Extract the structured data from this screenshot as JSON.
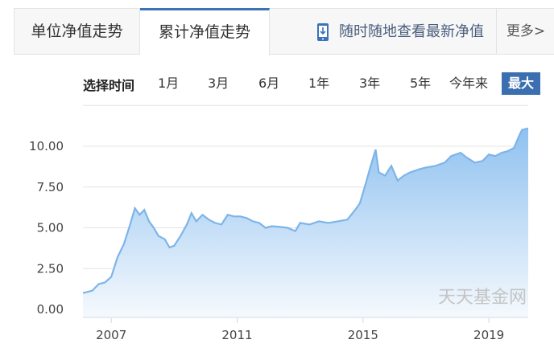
{
  "tabs": {
    "unit_nav": "单位净值走势",
    "cumulative_nav": "累计净值走势",
    "mobile_text": "随时随地查看最新净值",
    "more": "更多>"
  },
  "range": {
    "title": "选择时间",
    "options": [
      "1月",
      "3月",
      "6月",
      "1年",
      "3年",
      "5年",
      "今年来",
      "最大"
    ],
    "selected": "最大"
  },
  "colors": {
    "accent": "#3b6fb0",
    "line": "#7db4ea",
    "fill_top": "#8fc1f0",
    "fill_bottom": "#f5f9fd"
  },
  "watermark": "天天基金网",
  "chart_data": {
    "type": "area",
    "y_ticks": [
      "0.00",
      "2.50",
      "5.00",
      "7.50",
      "10.00"
    ],
    "x_ticks": [
      {
        "year": 2007,
        "label": "2007"
      },
      {
        "year": 2011,
        "label": "2011"
      },
      {
        "year": 2015,
        "label": "2015"
      },
      {
        "year": 2019,
        "label": "2019"
      }
    ],
    "xlim": [
      2006.1,
      2020.25
    ],
    "ylim": [
      0,
      10.2
    ],
    "grid": true,
    "points": [
      [
        2006.1,
        1.0
      ],
      [
        2006.4,
        1.15
      ],
      [
        2006.6,
        1.55
      ],
      [
        2006.8,
        1.65
      ],
      [
        2007.0,
        2.0
      ],
      [
        2007.2,
        3.2
      ],
      [
        2007.4,
        4.0
      ],
      [
        2007.6,
        5.2
      ],
      [
        2007.75,
        6.2
      ],
      [
        2007.9,
        5.8
      ],
      [
        2008.05,
        6.1
      ],
      [
        2008.2,
        5.4
      ],
      [
        2008.35,
        5.0
      ],
      [
        2008.5,
        4.5
      ],
      [
        2008.7,
        4.3
      ],
      [
        2008.85,
        3.8
      ],
      [
        2009.0,
        3.9
      ],
      [
        2009.2,
        4.5
      ],
      [
        2009.4,
        5.2
      ],
      [
        2009.55,
        5.9
      ],
      [
        2009.7,
        5.4
      ],
      [
        2009.9,
        5.8
      ],
      [
        2010.1,
        5.5
      ],
      [
        2010.3,
        5.3
      ],
      [
        2010.5,
        5.2
      ],
      [
        2010.7,
        5.8
      ],
      [
        2010.9,
        5.7
      ],
      [
        2011.1,
        5.7
      ],
      [
        2011.3,
        5.6
      ],
      [
        2011.5,
        5.4
      ],
      [
        2011.7,
        5.3
      ],
      [
        2011.9,
        5.0
      ],
      [
        2012.1,
        5.1
      ],
      [
        2012.4,
        5.05
      ],
      [
        2012.6,
        5.0
      ],
      [
        2012.85,
        4.8
      ],
      [
        2013.0,
        5.3
      ],
      [
        2013.3,
        5.2
      ],
      [
        2013.6,
        5.4
      ],
      [
        2013.9,
        5.3
      ],
      [
        2014.2,
        5.4
      ],
      [
        2014.5,
        5.5
      ],
      [
        2014.75,
        6.1
      ],
      [
        2014.9,
        6.5
      ],
      [
        2015.1,
        7.8
      ],
      [
        2015.2,
        8.5
      ],
      [
        2015.4,
        9.8
      ],
      [
        2015.5,
        8.4
      ],
      [
        2015.7,
        8.2
      ],
      [
        2015.9,
        8.8
      ],
      [
        2016.1,
        7.9
      ],
      [
        2016.3,
        8.2
      ],
      [
        2016.5,
        8.4
      ],
      [
        2016.8,
        8.6
      ],
      [
        2017.0,
        8.7
      ],
      [
        2017.3,
        8.8
      ],
      [
        2017.6,
        9.0
      ],
      [
        2017.8,
        9.4
      ],
      [
        2018.1,
        9.6
      ],
      [
        2018.3,
        9.3
      ],
      [
        2018.55,
        9.0
      ],
      [
        2018.8,
        9.1
      ],
      [
        2019.0,
        9.5
      ],
      [
        2019.2,
        9.4
      ],
      [
        2019.4,
        9.6
      ],
      [
        2019.6,
        9.7
      ],
      [
        2019.8,
        9.9
      ],
      [
        2019.95,
        10.6
      ],
      [
        2020.05,
        11.0
      ],
      [
        2020.25,
        11.1
      ]
    ]
  }
}
